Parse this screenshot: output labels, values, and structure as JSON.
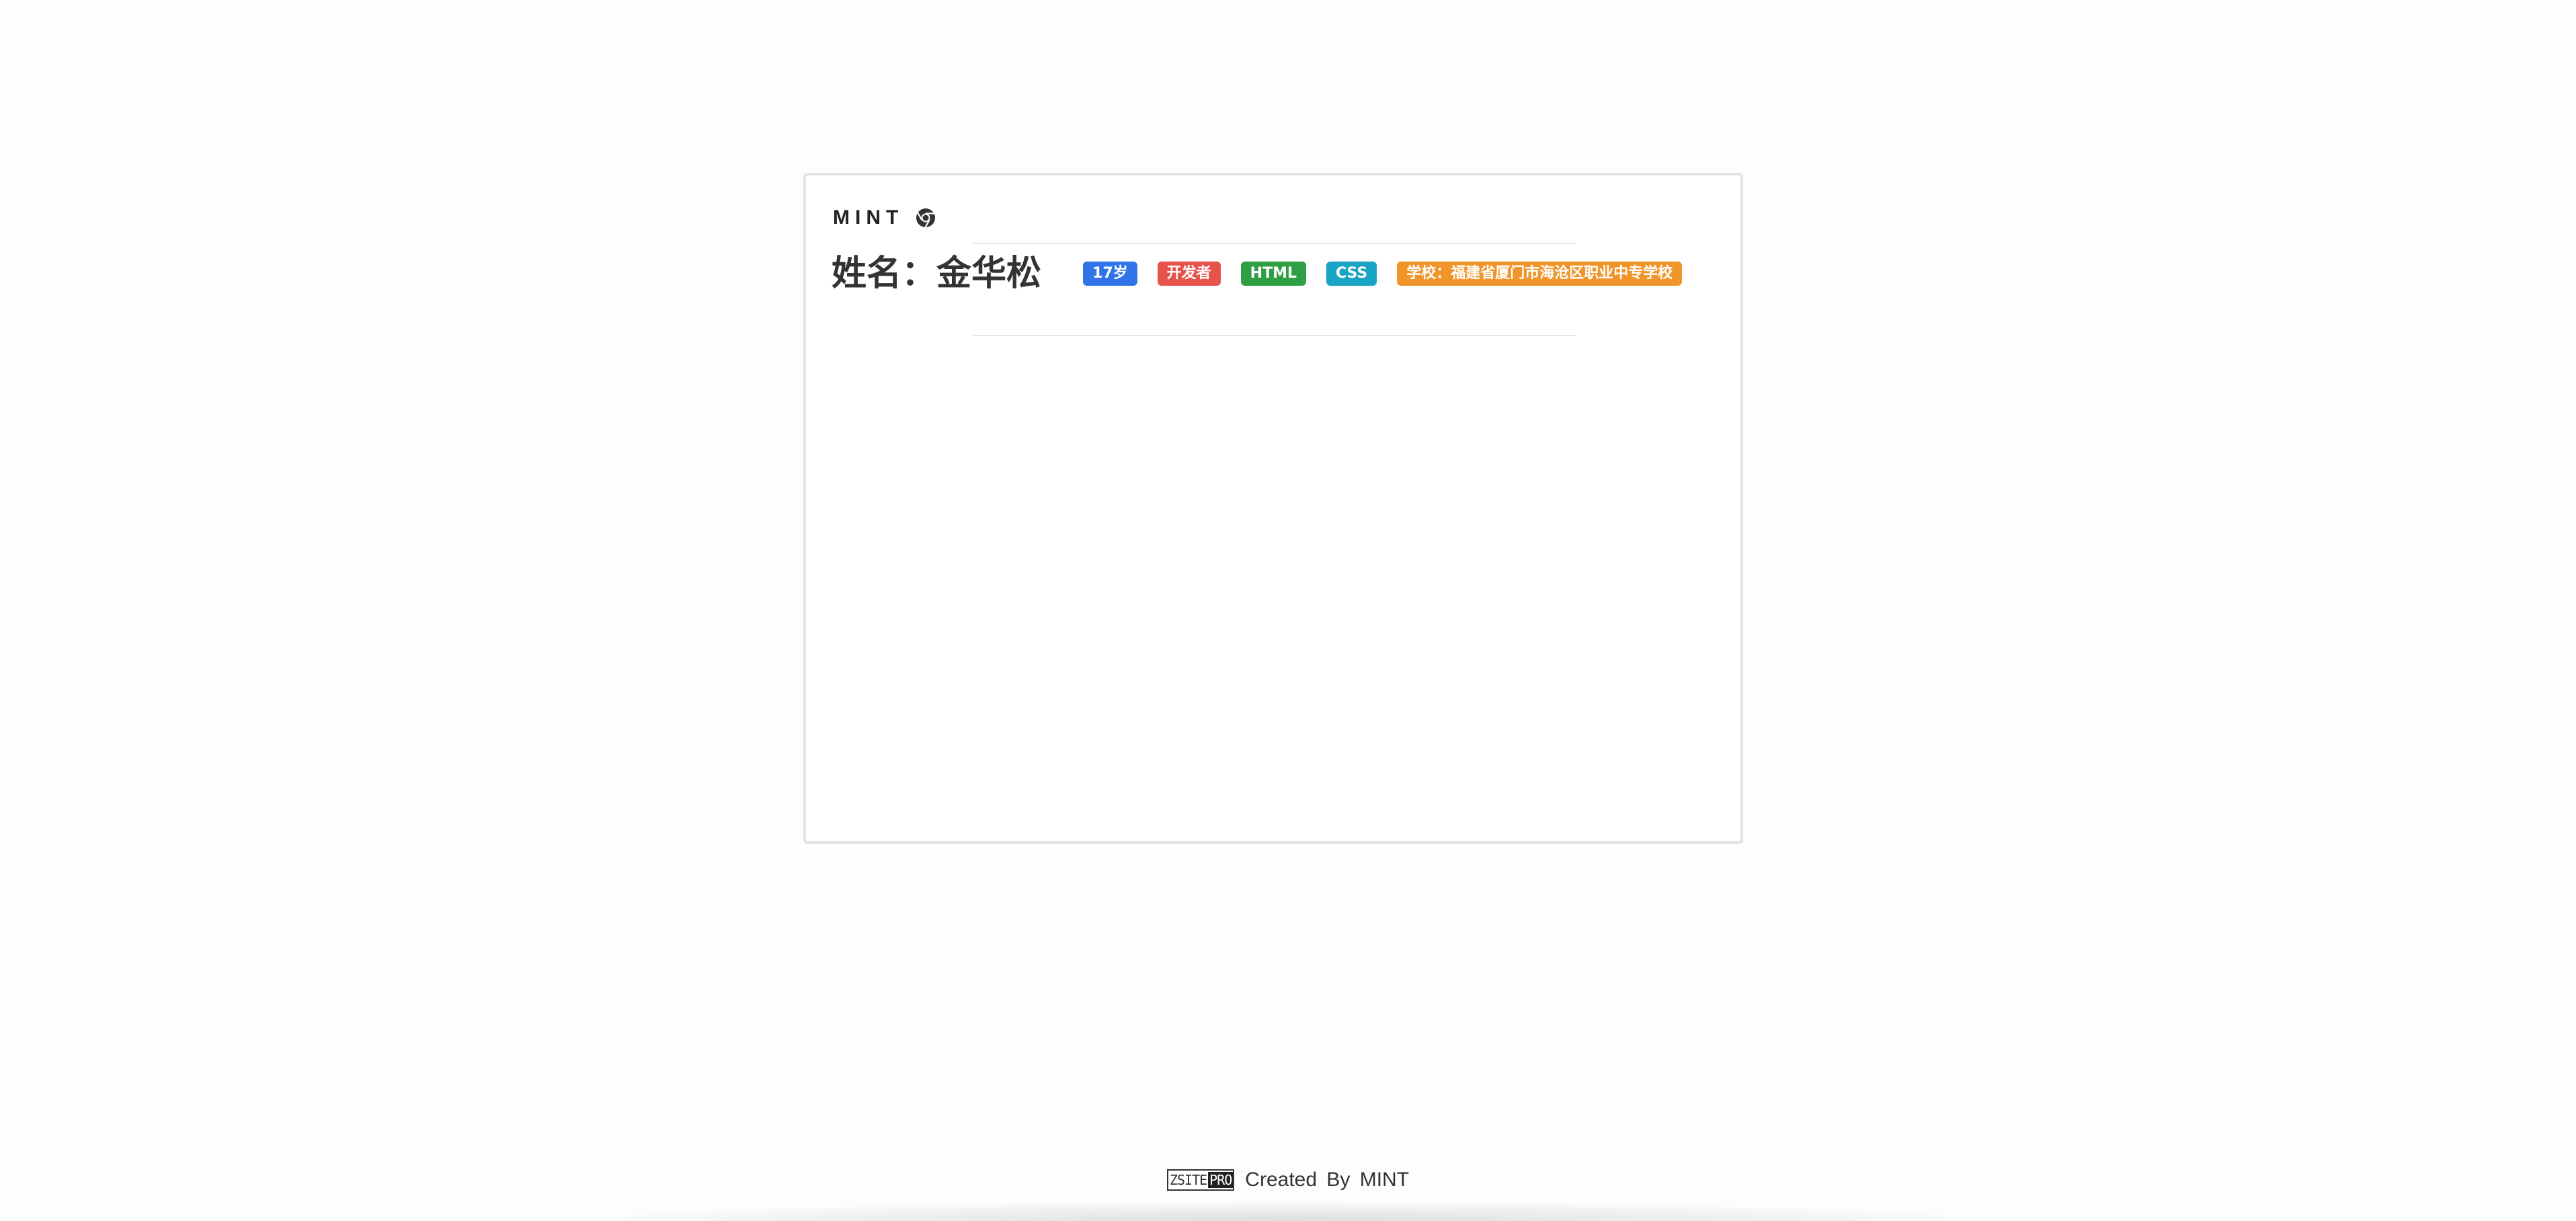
{
  "card": {
    "brand": {
      "text": "MINT",
      "icon": "chrome-logo-icon"
    },
    "name_label": "姓名：金华松",
    "tags": [
      {
        "label": "17岁",
        "color": "#2f74e8"
      },
      {
        "label": "开发者",
        "color": "#e5534b"
      },
      {
        "label": "HTML",
        "color": "#2ea043"
      },
      {
        "label": "CSS",
        "color": "#19a3c4"
      },
      {
        "label": "学校：福建省厦门市海沧区职业中专学校",
        "color": "#f0952a"
      }
    ]
  },
  "footer": {
    "logo_left": "ZSITE",
    "logo_right": "PRO",
    "text": "Created By MINT"
  }
}
